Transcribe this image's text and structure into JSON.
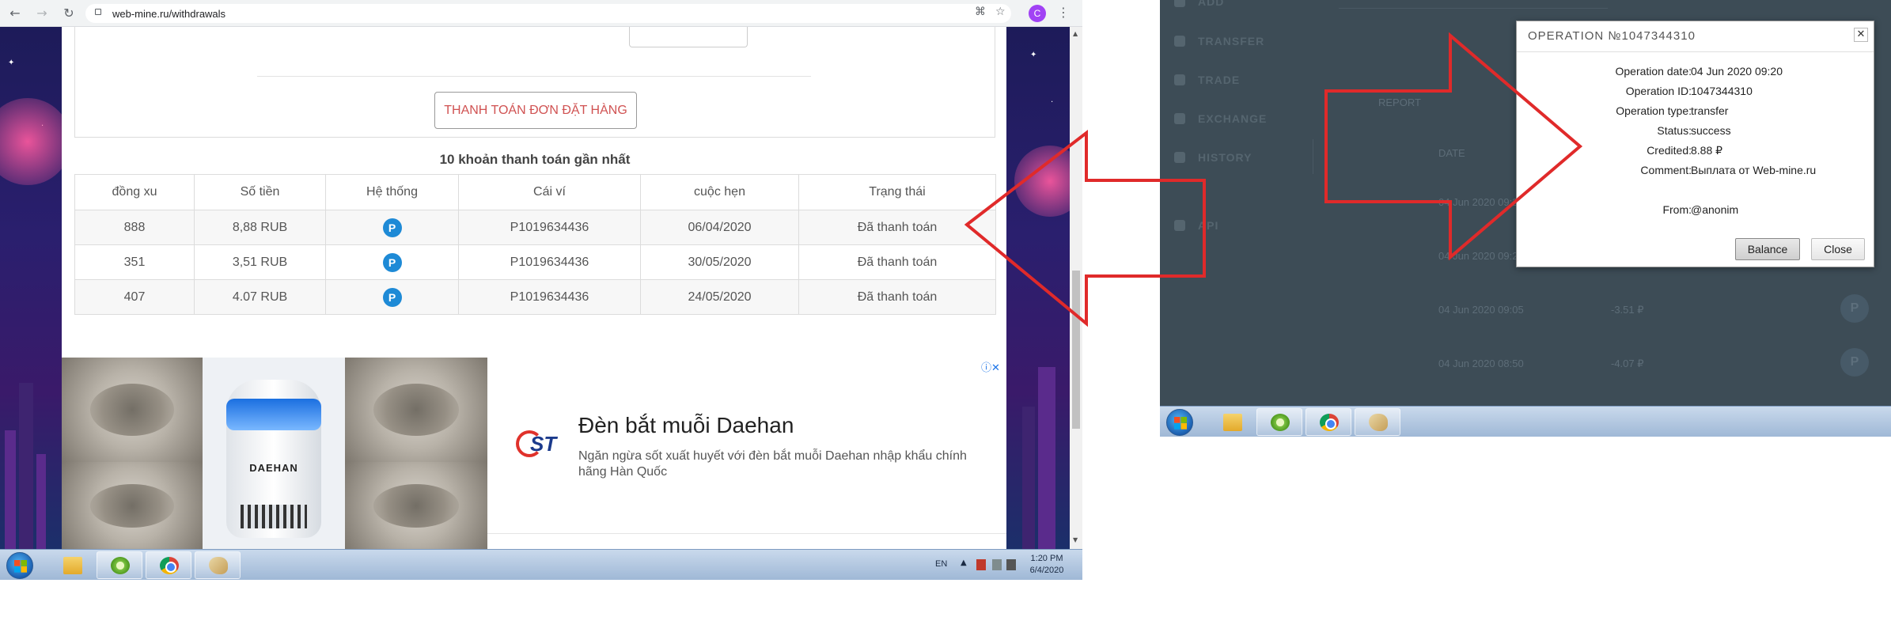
{
  "browser": {
    "url": "web-mine.ru/withdrawals",
    "avatar_letter": "C",
    "nav_icons": [
      "back-icon",
      "forward-icon",
      "reload-icon"
    ],
    "pay_button": "THANH TOÁN ĐƠN ĐẶT HÀNG",
    "table_caption": "10 khoản thanh toán gần nhất",
    "table": {
      "headers": [
        "đồng xu",
        "Số tiền",
        "Hệ thống",
        "Cái ví",
        "cuộc hẹn",
        "Trạng thái"
      ],
      "rows": [
        {
          "coins": "888",
          "amount": "8,88 RUB",
          "system": "P",
          "wallet": "P1019634436",
          "date": "06/04/2020",
          "status": "Đã thanh toán"
        },
        {
          "coins": "351",
          "amount": "3,51 RUB",
          "system": "P",
          "wallet": "P1019634436",
          "date": "30/05/2020",
          "status": "Đã thanh toán"
        },
        {
          "coins": "407",
          "amount": "4.07 RUB",
          "system": "P",
          "wallet": "P1019634436",
          "date": "24/05/2020",
          "status": "Đã thanh toán"
        }
      ]
    },
    "ad": {
      "brand_on_product": "DAEHAN",
      "logo": "ST",
      "title": "Đèn bắt muỗi Daehan",
      "description": "Ngăn ngừa sốt xuất huyết với đèn bắt muỗi Daehan nhập khẩu chính hãng Hàn Quốc",
      "info_icon": "ⓘ✕"
    }
  },
  "taskbar": {
    "language": "EN",
    "time": "1:20 PM",
    "date": "6/4/2020"
  },
  "wallet_app": {
    "sidebar": [
      "ADD",
      "TRANSFER",
      "TRADE",
      "EXCHANGE",
      "HISTORY",
      "API"
    ],
    "faint_table": {
      "header": "DATE",
      "rows": [
        "04 Jun 2020 09:20",
        "04 Jun 2020 09:20",
        "04 Jun 2020 09:05",
        "04 Jun 2020 08:50"
      ],
      "amounts": [
        "-3.51 ₽",
        "-4.07 ₽"
      ],
      "misc": "REPORT"
    }
  },
  "operation_modal": {
    "title": "OPERATION №1047344310",
    "close_glyph": "✕",
    "fields": [
      {
        "label": "Operation date:",
        "value": "04 Jun 2020 09:20"
      },
      {
        "label": "Operation ID:",
        "value": "1047344310"
      },
      {
        "label": "Operation type:",
        "value": "transfer"
      },
      {
        "label": "Status:",
        "value": "success"
      },
      {
        "label": "Credited:",
        "value": "8.88 ₽"
      },
      {
        "label": "Comment:",
        "value": "Выплата от Web-mine.ru"
      },
      {
        "label": "From:",
        "value": "@anonim"
      }
    ],
    "buttons": {
      "balance": "Balance",
      "close": "Close"
    }
  },
  "colors": {
    "arrow": "#e02a2a",
    "pay_button_text": "#d05252",
    "system_badge": "#1e8ad6",
    "wallet_bg": "#3d4c56"
  }
}
